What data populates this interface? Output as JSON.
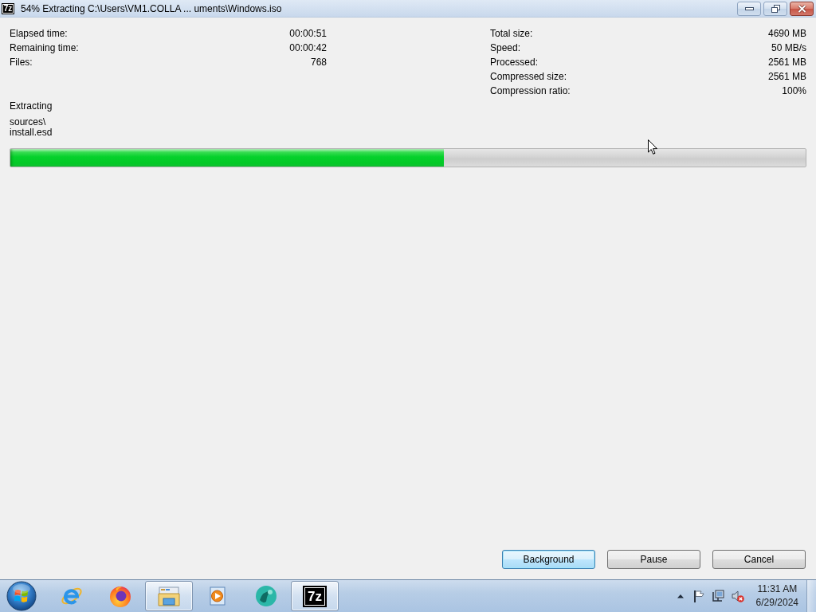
{
  "window": {
    "icon_text": "7z",
    "title": "54% Extracting C:\\Users\\VM1.COLLA ... uments\\Windows.iso"
  },
  "stats_left": [
    {
      "label": "Elapsed time:",
      "value": "00:00:51"
    },
    {
      "label": "Remaining time:",
      "value": "00:00:42"
    },
    {
      "label": "Files:",
      "value": "768"
    }
  ],
  "stats_right": [
    {
      "label": "Total size:",
      "value": "4690 MB"
    },
    {
      "label": "Speed:",
      "value": "50 MB/s"
    },
    {
      "label": "Processed:",
      "value": "2561 MB"
    },
    {
      "label": "Compressed size:",
      "value": "2561 MB"
    },
    {
      "label": "Compression ratio:",
      "value": "100%"
    }
  ],
  "operation": "Extracting",
  "current_file": {
    "folder": "sources\\",
    "name": "install.esd"
  },
  "progress": {
    "level": 0.545
  },
  "buttons": [
    {
      "label": "Background",
      "default": true
    },
    {
      "label": "Pause",
      "default": false
    },
    {
      "label": "Cancel",
      "default": false
    }
  ],
  "taskbar": {
    "items": [
      {
        "kind": "ering",
        "running": false
      },
      {
        "kind": "flameglobe",
        "running": false
      },
      {
        "kind": "folder",
        "running": true
      },
      {
        "kind": "player",
        "running": false
      },
      {
        "kind": "sphere",
        "running": false
      },
      {
        "kind": "archiver",
        "label": "7z",
        "running": true
      }
    ],
    "tray": {
      "volume_muted": true
    },
    "clock": {
      "time": "11:31 AM",
      "date": "6/29/2024"
    }
  }
}
